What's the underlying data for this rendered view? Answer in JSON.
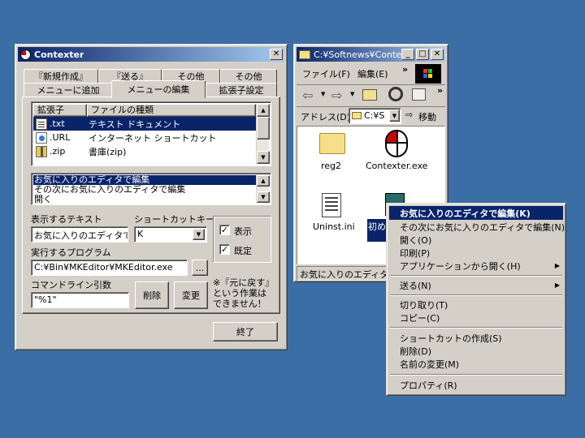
{
  "contexter": {
    "title": "Contexter",
    "tabs_back": [
      "『新規作成』",
      "『送る』",
      "その他",
      "その他"
    ],
    "tabs_front": [
      "メニューに追加",
      "メニューの編集",
      "拡張子設定"
    ],
    "list_headers": [
      "拡張子",
      "ファイルの種類"
    ],
    "list_rows": [
      {
        "ext": ".txt",
        "type": "テキスト ドキュメント"
      },
      {
        "ext": ".URL",
        "type": "インターネット ショートカット"
      },
      {
        "ext": ".zip",
        "type": "書庫(zip)"
      }
    ],
    "menu_list": [
      "お気に入りのエディタで編集",
      "その次にお気に入りのエディタで編集",
      "開く"
    ],
    "display_text_label": "表示するテキスト",
    "display_text_value": "お気に入りのエディタで",
    "shortcut_label": "ショートカットキー",
    "shortcut_value": "K",
    "check_show_label": "表示",
    "check_default_label": "既定",
    "program_label": "実行するプログラム",
    "program_value": "C:¥Bin¥MKEditor¥MKEditor.exe",
    "browse_label": "...",
    "cmdline_label": "コマンドライン引数",
    "cmdline_value": "\"%1\"",
    "delete_label": "削除",
    "change_label": "変更",
    "note_text": [
      "※『元に戻す』",
      "という作業は",
      "できません！"
    ],
    "finish_label": "終了"
  },
  "explorer": {
    "title": "C:¥Softnews¥Conte...",
    "menu": [
      "ファイル(F)",
      "編集(E)"
    ],
    "address_label": "アドレス(D)",
    "address_value": "C:¥S",
    "go_label": "移動",
    "files": [
      {
        "name": "reg2",
        "icon": "folder-icon"
      },
      {
        "name": "Contexter.exe",
        "icon": "contexter-app-icon"
      },
      {
        "name": "Uninst.ini",
        "icon": "ini-file-icon"
      },
      {
        "name": "初め",
        "icon": "document-icon"
      }
    ],
    "status_text": "お気に入りのエディタで編"
  },
  "context_menu": {
    "items": [
      {
        "label": "お気に入りのエディタで編集(K)",
        "bold": true,
        "highlight": true
      },
      {
        "label": "その次にお気に入りのエディタで編集(N)"
      },
      {
        "label": "開く(O)"
      },
      {
        "label": "印刷(P)"
      },
      {
        "label": "アプリケーションから開く(H)",
        "submenu": true
      },
      {
        "label": "送る(N)",
        "submenu": true
      },
      {
        "label": "切り取り(T)"
      },
      {
        "label": "コピー(C)"
      },
      {
        "label": "ショートカットの作成(S)"
      },
      {
        "label": "削除(D)"
      },
      {
        "label": "名前の変更(M)"
      },
      {
        "label": "プロパティ(R)"
      }
    ]
  }
}
